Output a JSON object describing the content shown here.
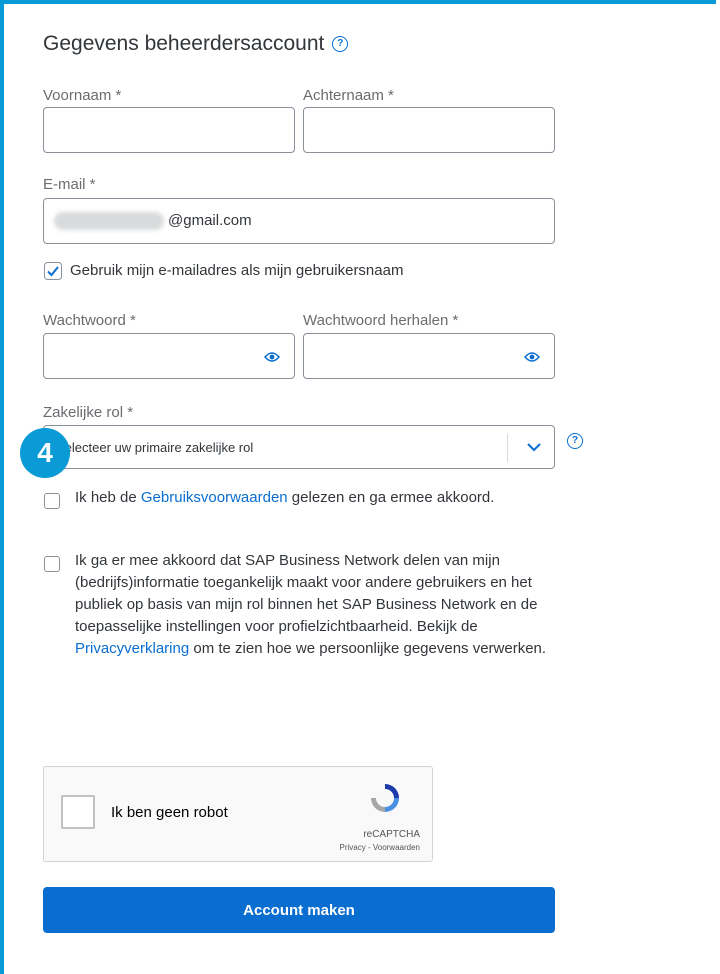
{
  "title": "Gegevens beheerdersaccount",
  "fields": {
    "first_name_label": "Voornaam *",
    "last_name_label": "Achternaam *",
    "email_label": "E-mail *",
    "email_value": "@gmail.com",
    "use_email_label": "Gebruik mijn e-mailadres als mijn gebruikersnaam",
    "password_label": "Wachtwoord *",
    "password_repeat_label": "Wachtwoord herhalen *",
    "role_label": "Zakelijke rol *",
    "role_value": "Selecteer uw primaire zakelijke rol"
  },
  "terms": {
    "prefix": "Ik heb de ",
    "link": "Gebruiksvoorwaarden",
    "suffix": " gelezen en ga ermee akkoord."
  },
  "privacy": {
    "text": "Ik ga er mee akkoord dat SAP Business Network delen van mijn (bedrijfs)informatie toegankelijk maakt voor andere gebruikers en het publiek op basis van mijn rol binnen het SAP Business Network en de toepasselijke instellingen voor profielzichtbaarheid. Bekijk de ",
    "link": "Privacyverklaring",
    "suffix": " om te zien hoe we persoonlijke gegevens verwerken."
  },
  "recaptcha": {
    "label": "Ik ben geen robot",
    "brand": "reCAPTCHA",
    "links": "Privacy - Voorwaarden"
  },
  "submit_label": "Account maken",
  "step_badge": "4",
  "colors": {
    "accent": "#0a9ad6",
    "button": "#0a6ed1",
    "link": "#0a6ed1"
  }
}
